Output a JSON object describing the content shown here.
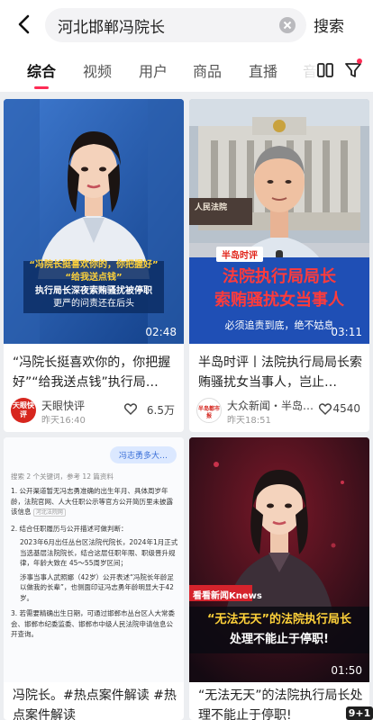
{
  "header": {
    "search_value": "河北邯郸冯院长",
    "search_button": "搜索"
  },
  "tabs": [
    {
      "label": "综合",
      "active": true
    },
    {
      "label": "视频"
    },
    {
      "label": "用户"
    },
    {
      "label": "商品"
    },
    {
      "label": "直播"
    },
    {
      "label": "音"
    }
  ],
  "cards": [
    {
      "thumb": {
        "caption_line1": "“冯院长挺喜欢你的，你把握好”",
        "caption_line2": "“给我送点钱”",
        "caption_line3": "执行局长深夜索贿骚扰被停职",
        "caption_line4": "更严的问责还在后头"
      },
      "duration": "02:48",
      "title": "“冯院长挺喜欢你的，你把握好”“给我送点钱”执行局…",
      "author": "天眼快评",
      "avatar_text": "天眼快评",
      "time": "昨天16:40",
      "likes": "6.5万"
    },
    {
      "thumb": {
        "court_sign": "人民法院",
        "tag": "半岛时评",
        "headline_line1": "法院执行局局长",
        "headline_line2": "索贿骚扰女当事人",
        "subline": "必须追责到底，绝不姑息"
      },
      "duration": "03:11",
      "title": "半岛时评丨法院执行局局长索贿骚扰女当事人，岂止…",
      "author": "大众新闻・半岛…",
      "avatar_text": "半岛都市报",
      "time": "昨天18:51",
      "likes": "4540"
    },
    {
      "thumb": {
        "query_bubble": "冯志勇多大…",
        "search_summary": "搜索 2 个关键词，参考 12 篇资料",
        "item1": "1. 公开渠道暂无冯志勇准确的出生年月、具体周岁年龄，法院官网、人大任职公示等官方公开简历里未披露该信息",
        "item1_tag": "河北法院网",
        "item2": "2. 结合任职履历与公开描述可做判断：",
        "bullet1": "2023年6月出任丛台区法院代院长，2024年1月正式当选基层法院院长，结合这层任职年限、职级晋升规律，年龄大致在 45～55周岁区间；",
        "bullet2": "涉事当事人武照娜（42岁）公开表述“冯院长年龄足以做我的长辈”，也侧面印证冯志勇年龄明显大于42岁。",
        "item3": "3. 若需要精确出生日期，可通过邯郸市丛台区人大常委会、邯郸市纪委监委、邯郸市中级人民法院申请信息公开查询。"
      },
      "title": "冯院长。#热点案件解读 #热点案件解读"
    },
    {
      "thumb": {
        "station_logo": "看看新闻Knews",
        "banner_line1": "“无法无天”的法院执行局长",
        "banner_line2": "处理不能止于停职!"
      },
      "duration": "01:50",
      "title": "“无法无天”的法院执行局长处理不能止于停职!"
    }
  ],
  "watermark": "9+1",
  "colors": {
    "accent": "#fe2c55",
    "page_bg": "#eceef1",
    "headline_red": "#ff2d2d",
    "banner_yellow": "#ffd23a"
  }
}
